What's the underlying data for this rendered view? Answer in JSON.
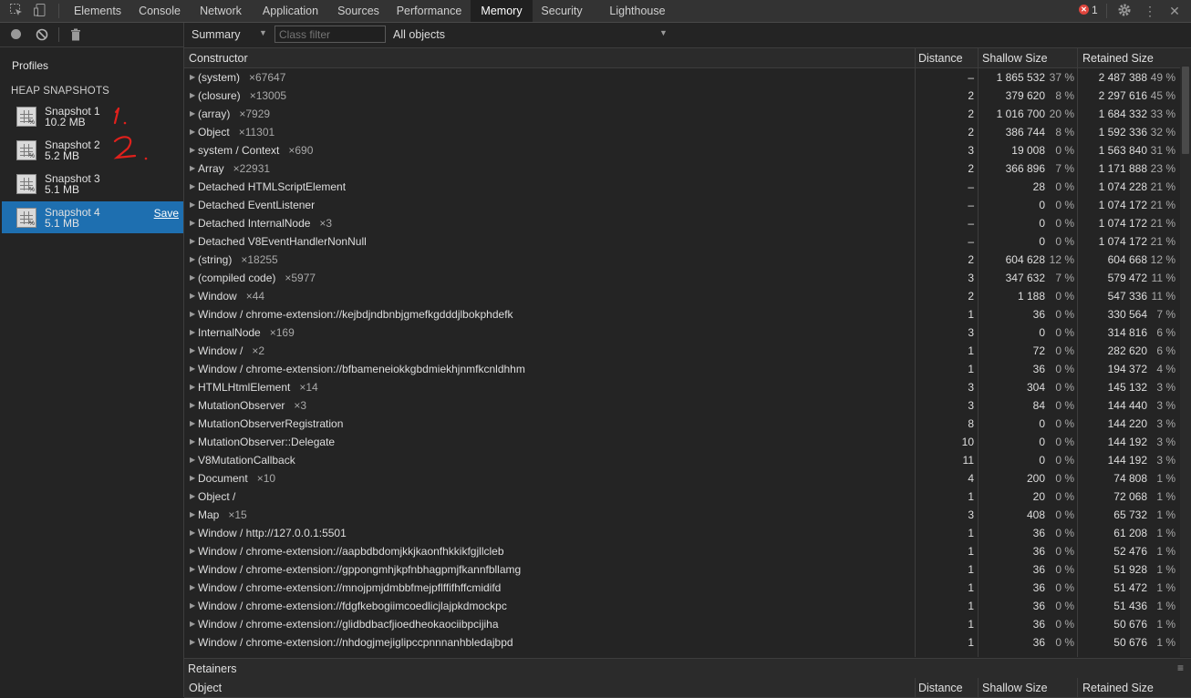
{
  "tabs": [
    "Elements",
    "Console",
    "Network",
    "Application",
    "Sources",
    "Performance",
    "Memory",
    "Security",
    "Lighthouse"
  ],
  "active_tab": "Memory",
  "error_count": "1",
  "sidebar": {
    "profiles_title": "Profiles",
    "heap_title": "HEAP SNAPSHOTS",
    "snapshots": [
      {
        "name": "Snapshot 1",
        "size": "10.2 MB"
      },
      {
        "name": "Snapshot 2",
        "size": "5.2 MB"
      },
      {
        "name": "Snapshot 3",
        "size": "5.1 MB"
      },
      {
        "name": "Snapshot 4",
        "size": "5.1 MB",
        "save": "Save"
      }
    ]
  },
  "filterbar": {
    "view": "Summary",
    "class_filter_placeholder": "Class filter",
    "objects": "All objects"
  },
  "columns": {
    "constructor": "Constructor",
    "distance": "Distance",
    "shallow": "Shallow Size",
    "retained": "Retained Size"
  },
  "retainers": {
    "title": "Retainers",
    "object": "Object",
    "distance": "Distance",
    "shallow": "Shallow Size",
    "retained": "Retained Size"
  },
  "rows": [
    {
      "name": "(system)",
      "count": "×67647",
      "dist": "–",
      "sh": "1 865 532",
      "shp": "37 %",
      "rt": "2 487 388",
      "rtp": "49 %"
    },
    {
      "name": "(closure)",
      "count": "×13005",
      "dist": "2",
      "sh": "379 620",
      "shp": "8 %",
      "rt": "2 297 616",
      "rtp": "45 %"
    },
    {
      "name": "(array)",
      "count": "×7929",
      "dist": "2",
      "sh": "1 016 700",
      "shp": "20 %",
      "rt": "1 684 332",
      "rtp": "33 %"
    },
    {
      "name": "Object",
      "count": "×11301",
      "dist": "2",
      "sh": "386 744",
      "shp": "8 %",
      "rt": "1 592 336",
      "rtp": "32 %"
    },
    {
      "name": "system / Context",
      "count": "×690",
      "dist": "3",
      "sh": "19 008",
      "shp": "0 %",
      "rt": "1 563 840",
      "rtp": "31 %"
    },
    {
      "name": "Array",
      "count": "×22931",
      "dist": "2",
      "sh": "366 896",
      "shp": "7 %",
      "rt": "1 171 888",
      "rtp": "23 %"
    },
    {
      "name": "Detached HTMLScriptElement",
      "count": "",
      "dist": "–",
      "sh": "28",
      "shp": "0 %",
      "rt": "1 074 228",
      "rtp": "21 %"
    },
    {
      "name": "Detached EventListener",
      "count": "",
      "dist": "–",
      "sh": "0",
      "shp": "0 %",
      "rt": "1 074 172",
      "rtp": "21 %"
    },
    {
      "name": "Detached InternalNode",
      "count": "×3",
      "dist": "–",
      "sh": "0",
      "shp": "0 %",
      "rt": "1 074 172",
      "rtp": "21 %"
    },
    {
      "name": "Detached V8EventHandlerNonNull",
      "count": "",
      "dist": "–",
      "sh": "0",
      "shp": "0 %",
      "rt": "1 074 172",
      "rtp": "21 %"
    },
    {
      "name": "(string)",
      "count": "×18255",
      "dist": "2",
      "sh": "604 628",
      "shp": "12 %",
      "rt": "604 668",
      "rtp": "12 %"
    },
    {
      "name": "(compiled code)",
      "count": "×5977",
      "dist": "3",
      "sh": "347 632",
      "shp": "7 %",
      "rt": "579 472",
      "rtp": "11 %"
    },
    {
      "name": "Window",
      "count": "×44",
      "dist": "2",
      "sh": "1 188",
      "shp": "0 %",
      "rt": "547 336",
      "rtp": "11 %"
    },
    {
      "name": "Window / chrome-extension://kejbdjndbnbjgmefkgdddjlbokphdefk",
      "count": "",
      "dist": "1",
      "sh": "36",
      "shp": "0 %",
      "rt": "330 564",
      "rtp": "7 %"
    },
    {
      "name": "InternalNode",
      "count": "×169",
      "dist": "3",
      "sh": "0",
      "shp": "0 %",
      "rt": "314 816",
      "rtp": "6 %"
    },
    {
      "name": "Window /",
      "count": "×2",
      "dist": "1",
      "sh": "72",
      "shp": "0 %",
      "rt": "282 620",
      "rtp": "6 %"
    },
    {
      "name": "Window / chrome-extension://bfbameneiokkgbdmiekhjnmfkcnldhhm",
      "count": "",
      "dist": "1",
      "sh": "36",
      "shp": "0 %",
      "rt": "194 372",
      "rtp": "4 %"
    },
    {
      "name": "HTMLHtmlElement",
      "count": "×14",
      "dist": "3",
      "sh": "304",
      "shp": "0 %",
      "rt": "145 132",
      "rtp": "3 %"
    },
    {
      "name": "MutationObserver",
      "count": "×3",
      "dist": "3",
      "sh": "84",
      "shp": "0 %",
      "rt": "144 440",
      "rtp": "3 %"
    },
    {
      "name": "MutationObserverRegistration",
      "count": "",
      "dist": "8",
      "sh": "0",
      "shp": "0 %",
      "rt": "144 220",
      "rtp": "3 %"
    },
    {
      "name": "MutationObserver::Delegate",
      "count": "",
      "dist": "10",
      "sh": "0",
      "shp": "0 %",
      "rt": "144 192",
      "rtp": "3 %"
    },
    {
      "name": "V8MutationCallback",
      "count": "",
      "dist": "11",
      "sh": "0",
      "shp": "0 %",
      "rt": "144 192",
      "rtp": "3 %"
    },
    {
      "name": "Document",
      "count": "×10",
      "dist": "4",
      "sh": "200",
      "shp": "0 %",
      "rt": "74 808",
      "rtp": "1 %"
    },
    {
      "name": "Object /",
      "count": "",
      "dist": "1",
      "sh": "20",
      "shp": "0 %",
      "rt": "72 068",
      "rtp": "1 %"
    },
    {
      "name": "Map",
      "count": "×15",
      "dist": "3",
      "sh": "408",
      "shp": "0 %",
      "rt": "65 732",
      "rtp": "1 %"
    },
    {
      "name": "Window / http://127.0.0.1:5501",
      "count": "",
      "dist": "1",
      "sh": "36",
      "shp": "0 %",
      "rt": "61 208",
      "rtp": "1 %"
    },
    {
      "name": "Window / chrome-extension://aapbdbdomjkkjkaonfhkkikfgjllcleb",
      "count": "",
      "dist": "1",
      "sh": "36",
      "shp": "0 %",
      "rt": "52 476",
      "rtp": "1 %"
    },
    {
      "name": "Window / chrome-extension://gppongmhjkpfnbhagpmjfkannfbllamg",
      "count": "",
      "dist": "1",
      "sh": "36",
      "shp": "0 %",
      "rt": "51 928",
      "rtp": "1 %"
    },
    {
      "name": "Window / chrome-extension://mnojpmjdmbbfmejpflffifhffcmidifd",
      "count": "",
      "dist": "1",
      "sh": "36",
      "shp": "0 %",
      "rt": "51 472",
      "rtp": "1 %"
    },
    {
      "name": "Window / chrome-extension://fdgfkebogiimcoedlicjlajpkdmockpc",
      "count": "",
      "dist": "1",
      "sh": "36",
      "shp": "0 %",
      "rt": "51 436",
      "rtp": "1 %"
    },
    {
      "name": "Window / chrome-extension://glidbdbacfjioedheokaociibpcijiha",
      "count": "",
      "dist": "1",
      "sh": "36",
      "shp": "0 %",
      "rt": "50 676",
      "rtp": "1 %"
    },
    {
      "name": "Window / chrome-extension://nhdogjmejiglipccpnnnanhbledajbpd",
      "count": "",
      "dist": "1",
      "sh": "36",
      "shp": "0 %",
      "rt": "50 676",
      "rtp": "1 %"
    }
  ],
  "colors": {
    "selected": "#1e6fb0",
    "error": "#e0453d",
    "annotation": "#e0201c"
  }
}
